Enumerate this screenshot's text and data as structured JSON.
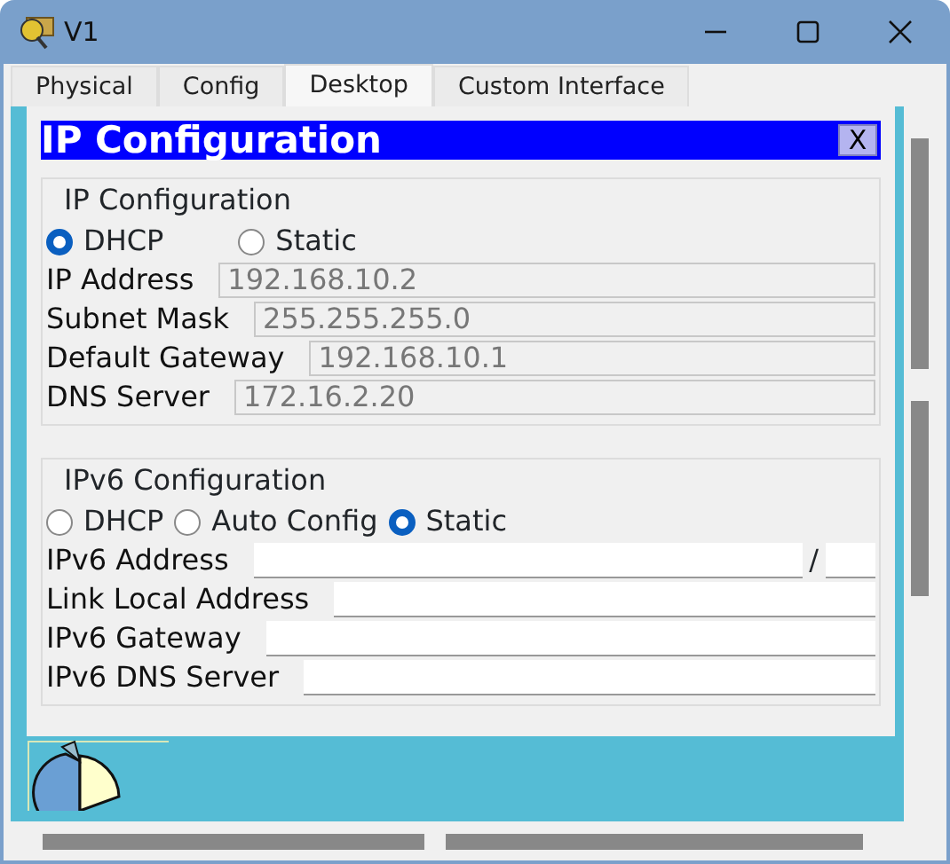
{
  "window": {
    "title": "V1",
    "controls": [
      {
        "kind": "minimize"
      },
      {
        "kind": "maximize"
      },
      {
        "kind": "close"
      }
    ]
  },
  "tabs": [
    {
      "label": "Physical",
      "selected": false
    },
    {
      "label": "Config",
      "selected": false
    },
    {
      "label": "Desktop",
      "selected": true
    },
    {
      "label": "Custom Interface",
      "selected": false
    }
  ],
  "dialog": {
    "title": "IP Configuration",
    "close": "X",
    "ipv4": {
      "legend": "IP Configuration",
      "modes": [
        {
          "label": "DHCP",
          "selected": true
        },
        {
          "label": "Static",
          "selected": false
        }
      ],
      "fields": [
        {
          "label": "IP Address",
          "value": "192.168.10.2"
        },
        {
          "label": "Subnet Mask",
          "value": "255.255.255.0"
        },
        {
          "label": "Default Gateway",
          "value": "192.168.10.1"
        },
        {
          "label": "DNS Server",
          "value": "172.16.2.20"
        }
      ]
    },
    "ipv6": {
      "legend": "IPv6 Configuration",
      "modes": [
        {
          "label": "DHCP",
          "selected": false
        },
        {
          "label": "Auto Config",
          "selected": false
        },
        {
          "label": "Static",
          "selected": true
        }
      ],
      "fields": [
        {
          "label": "IPv6 Address",
          "kind": "prefixed",
          "separator": "/"
        },
        {
          "label": "Link Local Address",
          "kind": "plain"
        },
        {
          "label": "IPv6 Gateway",
          "kind": "plain"
        },
        {
          "label": "IPv6 DNS Server",
          "kind": "plain"
        }
      ]
    }
  }
}
